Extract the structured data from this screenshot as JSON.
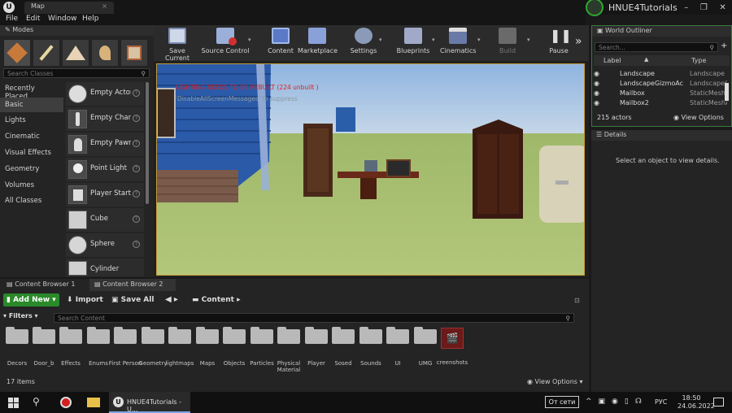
{
  "window": {
    "map_tab": "Map",
    "project_name": "HNUE4Tutorials",
    "menu": [
      "File",
      "Edit",
      "Window",
      "Help"
    ]
  },
  "modes": {
    "tab": "Modes",
    "search_placeholder": "Search Classes",
    "categories": [
      "Recently Placed",
      "Basic",
      "Lights",
      "Cinematic",
      "Visual Effects",
      "Geometry",
      "Volumes",
      "All Classes"
    ],
    "items": [
      "Empty Actor",
      "Empty Chara",
      "Empty Pawn",
      "Point Light",
      "Player Start",
      "Cube",
      "Sphere",
      "Cylinder"
    ]
  },
  "toolbar": {
    "buttons": [
      "Save Current",
      "Source Control",
      "Content",
      "Marketplace",
      "Settings",
      "Blueprints",
      "Cinematics",
      "Build",
      "Pause"
    ]
  },
  "viewport": {
    "warning": "LIGHTING NEEDS TO BE REBUILT (224 unbuilt )",
    "hint": "'DisableAllScreenMessages' to suppress"
  },
  "outliner": {
    "tab": "World Outliner",
    "search_placeholder": "Search...",
    "col_label": "Label",
    "col_type": "Type",
    "rows": [
      {
        "label": "Landscape",
        "type": "Landscape"
      },
      {
        "label": "LandscapeGizmoAc",
        "type": "LandscapeG"
      },
      {
        "label": "Mailbox",
        "type": "StaticMeshA"
      },
      {
        "label": "Mailbox2",
        "type": "StaticMeshA"
      }
    ],
    "count": "215 actors",
    "view_options": "View Options"
  },
  "details": {
    "tab": "Details",
    "empty_text": "Select an object to view details."
  },
  "content_browser": {
    "tabs": [
      "Content Browser 1",
      "Content Browser 2"
    ],
    "add_new": "Add New",
    "import": "Import",
    "save_all": "Save All",
    "path": "Content",
    "filters": "Filters",
    "search_placeholder": "Search Content",
    "folders": [
      "Decors",
      "Door_b",
      "Effects",
      "Enums",
      "First Person",
      "Geometry",
      "lightmaps",
      "Maps",
      "Objects",
      "Particles",
      "Physical Material",
      "Player",
      "Sosed",
      "Sounds",
      "UI",
      "UMG",
      "creenshots"
    ],
    "items_count": "17 items",
    "view_options": "View Options"
  },
  "taskbar": {
    "app_label": "HNUE4Tutorials - U...",
    "network": "От сети",
    "lang": "РУС",
    "time": "18:50",
    "date": "24.06.2022"
  }
}
